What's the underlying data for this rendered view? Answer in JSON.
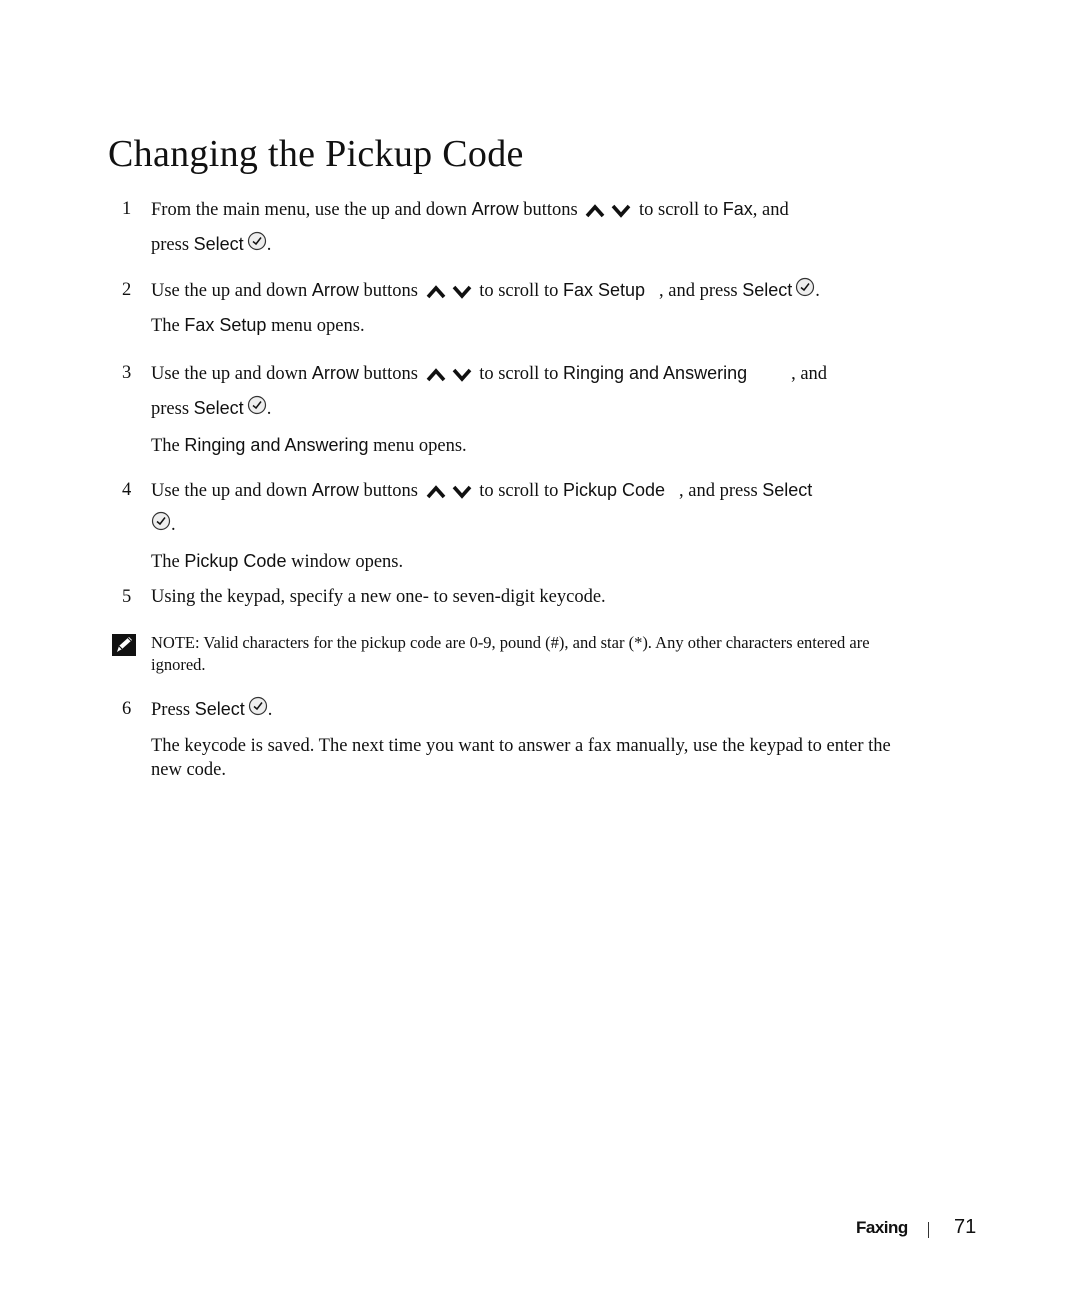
{
  "page": {
    "title": "Changing the Pickup Code",
    "steps": [
      {
        "num": "1",
        "p1": "From the main menu, use the up and down ",
        "ui1": "Arrow",
        "p2": " buttons ",
        "p3": " to scroll to ",
        "ui2": "Fax",
        "p4": ", and",
        "line2_pre": "press ",
        "ui3": "Select",
        "line2_post": "."
      },
      {
        "num": "2",
        "p1": "Use the up and down ",
        "ui1": "Arrow",
        "p2": " buttons ",
        "p3": " to scroll to ",
        "ui2": "Fax Setup",
        "p4": ", and press ",
        "ui3": "Select",
        "p5": ".",
        "result_pre": "The ",
        "result_ui": "Fax Setup",
        "result_post": " menu opens."
      },
      {
        "num": "3",
        "p1": "Use the up and down ",
        "ui1": "Arrow",
        "p2": " buttons ",
        "p3": " to scroll to ",
        "ui2": "Ringing and Answering",
        "p4": ", and",
        "line2_pre": "press ",
        "ui3": "Select",
        "line2_post": ".",
        "result_pre": "The ",
        "result_ui": "Ringing and Answering",
        "result_post": " menu opens."
      },
      {
        "num": "4",
        "p1": "Use the up and down ",
        "ui1": "Arrow",
        "p2": " buttons ",
        "p3": " to scroll to ",
        "ui2": "Pickup Code",
        "p4": ", and press ",
        "ui3": "Select",
        "line2_post": ".",
        "result_pre": "The ",
        "result_ui": "Pickup Code",
        "result_post": " window opens."
      },
      {
        "num": "5",
        "text": "Using the keypad, specify a new one- to seven-digit keycode."
      },
      {
        "num": "6",
        "p1": "Press ",
        "ui1": "Select",
        "p2": ".",
        "result": "The keycode is saved. The next time you want to answer a fax manually, use the keypad to enter the new code."
      }
    ],
    "note": {
      "label": "NOTE:",
      "text": " Valid characters for the pickup code are 0-9, pound (#), and star (*). Any other characters entered are ignored."
    },
    "footer": {
      "section": "Faxing",
      "page_number": "71"
    }
  }
}
